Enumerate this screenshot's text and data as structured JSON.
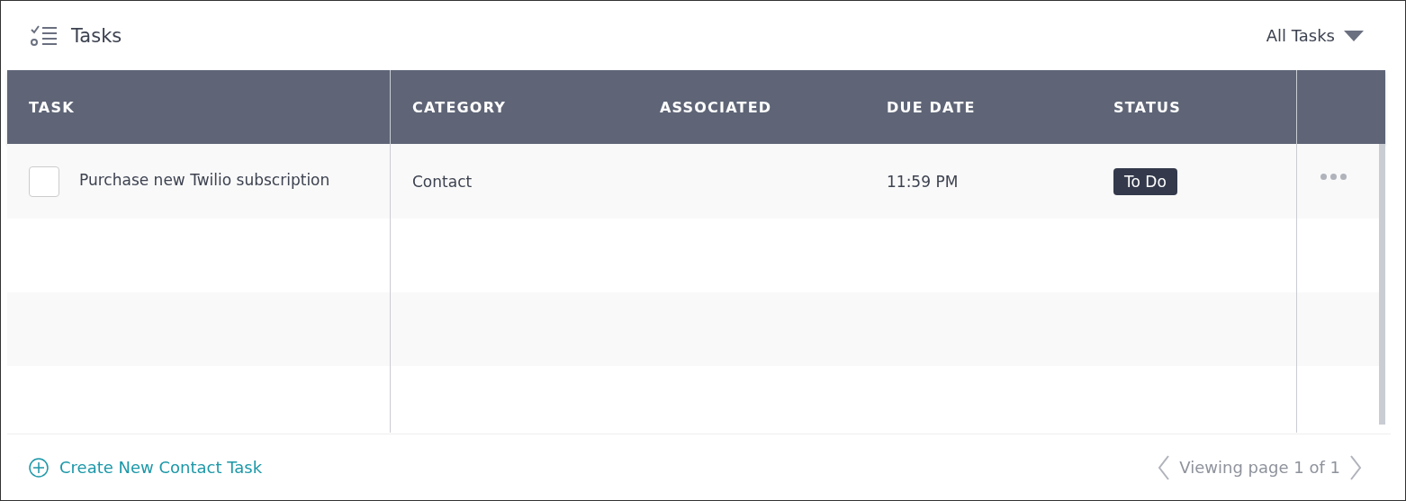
{
  "header": {
    "title": "Tasks",
    "filter": "All Tasks"
  },
  "table": {
    "columns": [
      "TASK",
      "CATEGORY",
      "ASSOCIATED",
      "DUE DATE",
      "STATUS"
    ],
    "rows": [
      {
        "checked": false,
        "task": "Purchase new Twilio subscription",
        "category": "Contact",
        "due_date": "11:59 PM",
        "status": "To Do"
      }
    ]
  },
  "footer": {
    "create_link": "Create New Contact Task",
    "pagination": "Viewing page 1 of 1"
  }
}
